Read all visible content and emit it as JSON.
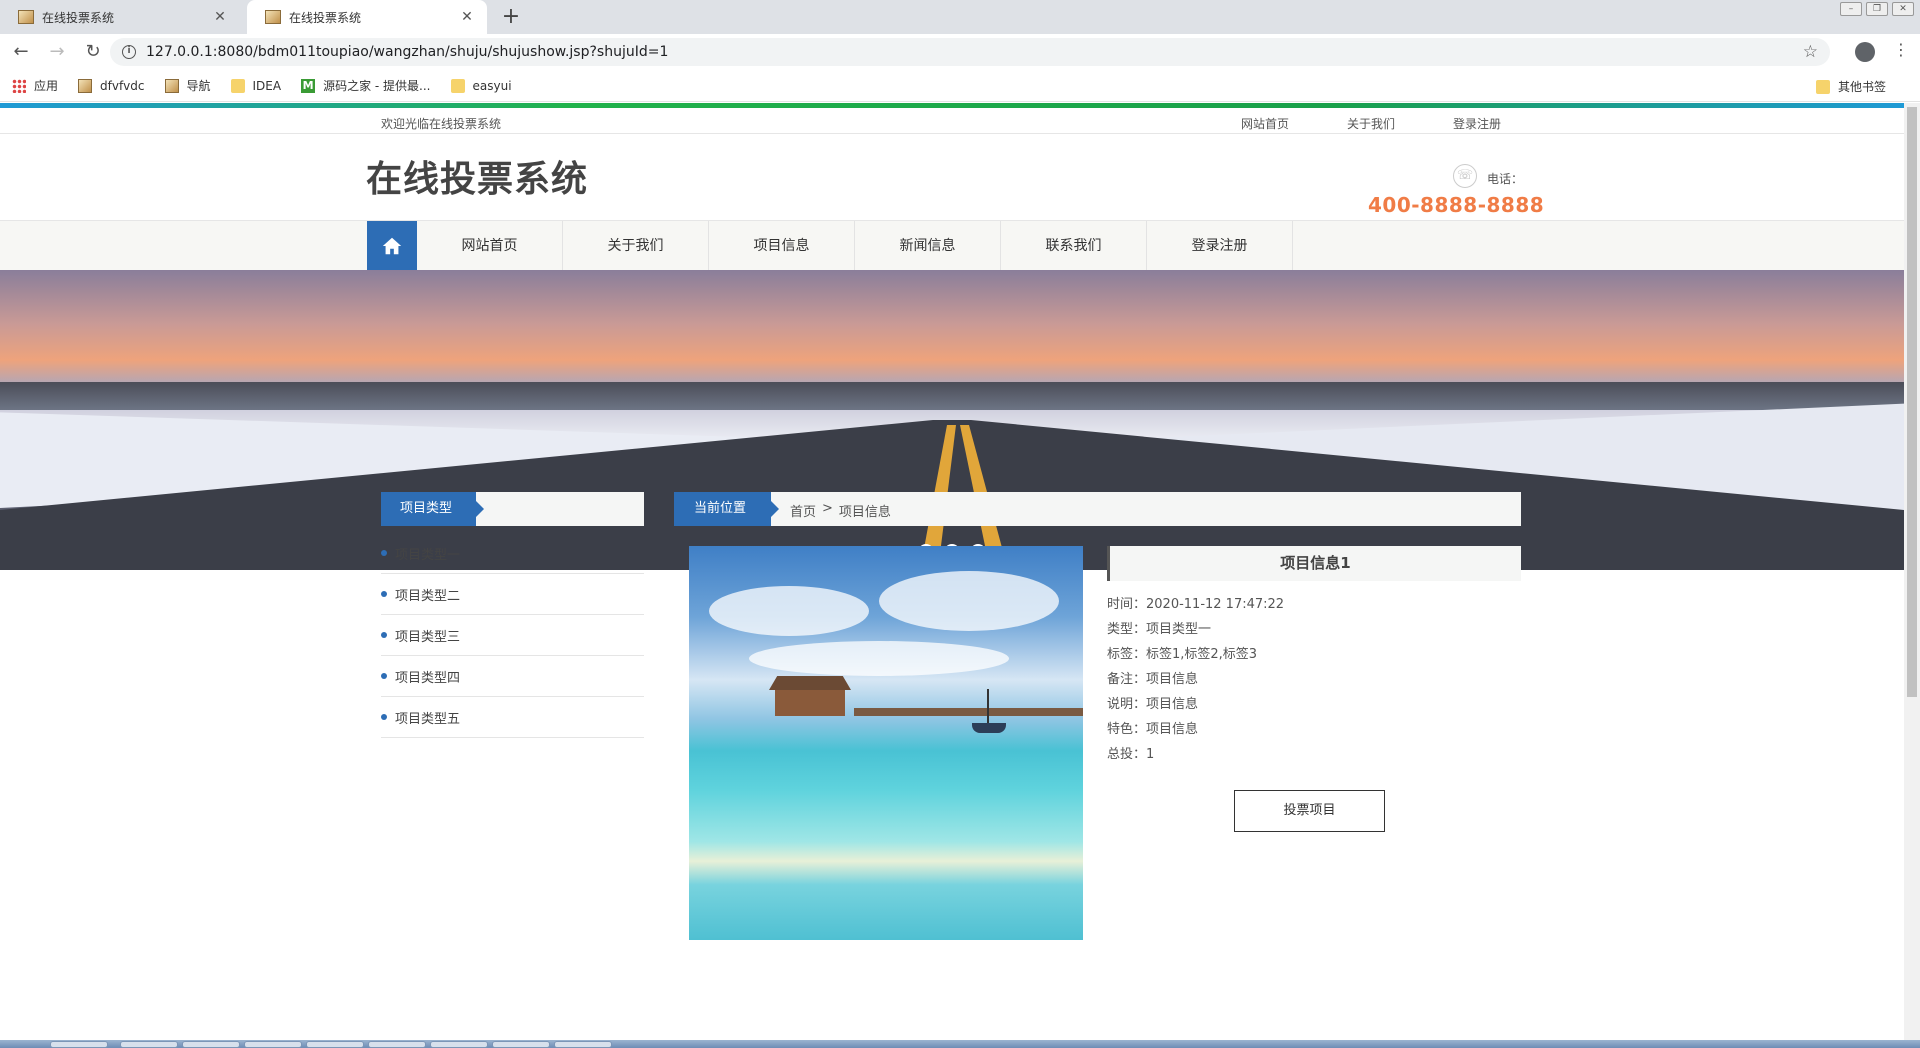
{
  "browser": {
    "tabs": [
      {
        "title": "在线投票系统",
        "active": false
      },
      {
        "title": "在线投票系统",
        "active": true
      }
    ],
    "new_tab_label": "+",
    "url": "127.0.0.1:8080/bdm011toupiao/wangzhan/shuju/shujushow.jsp?shujuId=1",
    "bookmarks": [
      "应用",
      "dfvfvdc",
      "导航",
      "IDEA",
      "源码之家 - 提供最...",
      "easyui"
    ],
    "other_bookmarks": "其他书签"
  },
  "site": {
    "welcome": "欢迎光临在线投票系统",
    "top_links": [
      "网站首页",
      "关于我们",
      "登录注册"
    ],
    "title": "在线投票系统",
    "phone_label": "电话：",
    "phone_number": "400-8888-8888",
    "nav": [
      "网站首页",
      "关于我们",
      "项目信息",
      "新闻信息",
      "联系我们",
      "登录注册"
    ],
    "banner_dots": 3,
    "banner_active_dot": 2
  },
  "sidebar": {
    "heading": "项目类型",
    "items": [
      "项目类型一",
      "项目类型二",
      "项目类型三",
      "项目类型四",
      "项目类型五"
    ]
  },
  "breadcrumb": {
    "label": "当前位置",
    "home": "首页",
    "separator": ">",
    "current": "项目信息"
  },
  "item": {
    "title": "项目信息1",
    "rows": [
      "时间：2020-11-12 17:47:22",
      "类型：项目类型一",
      "标签：标签1,标签2,标签3",
      "备注：项目信息",
      "说明：项目信息",
      "特色：项目信息",
      "总投：1"
    ],
    "vote_button": "投票项目"
  },
  "colors": {
    "brand_blue": "#2d6db5",
    "phone_orange": "#f07c46"
  }
}
